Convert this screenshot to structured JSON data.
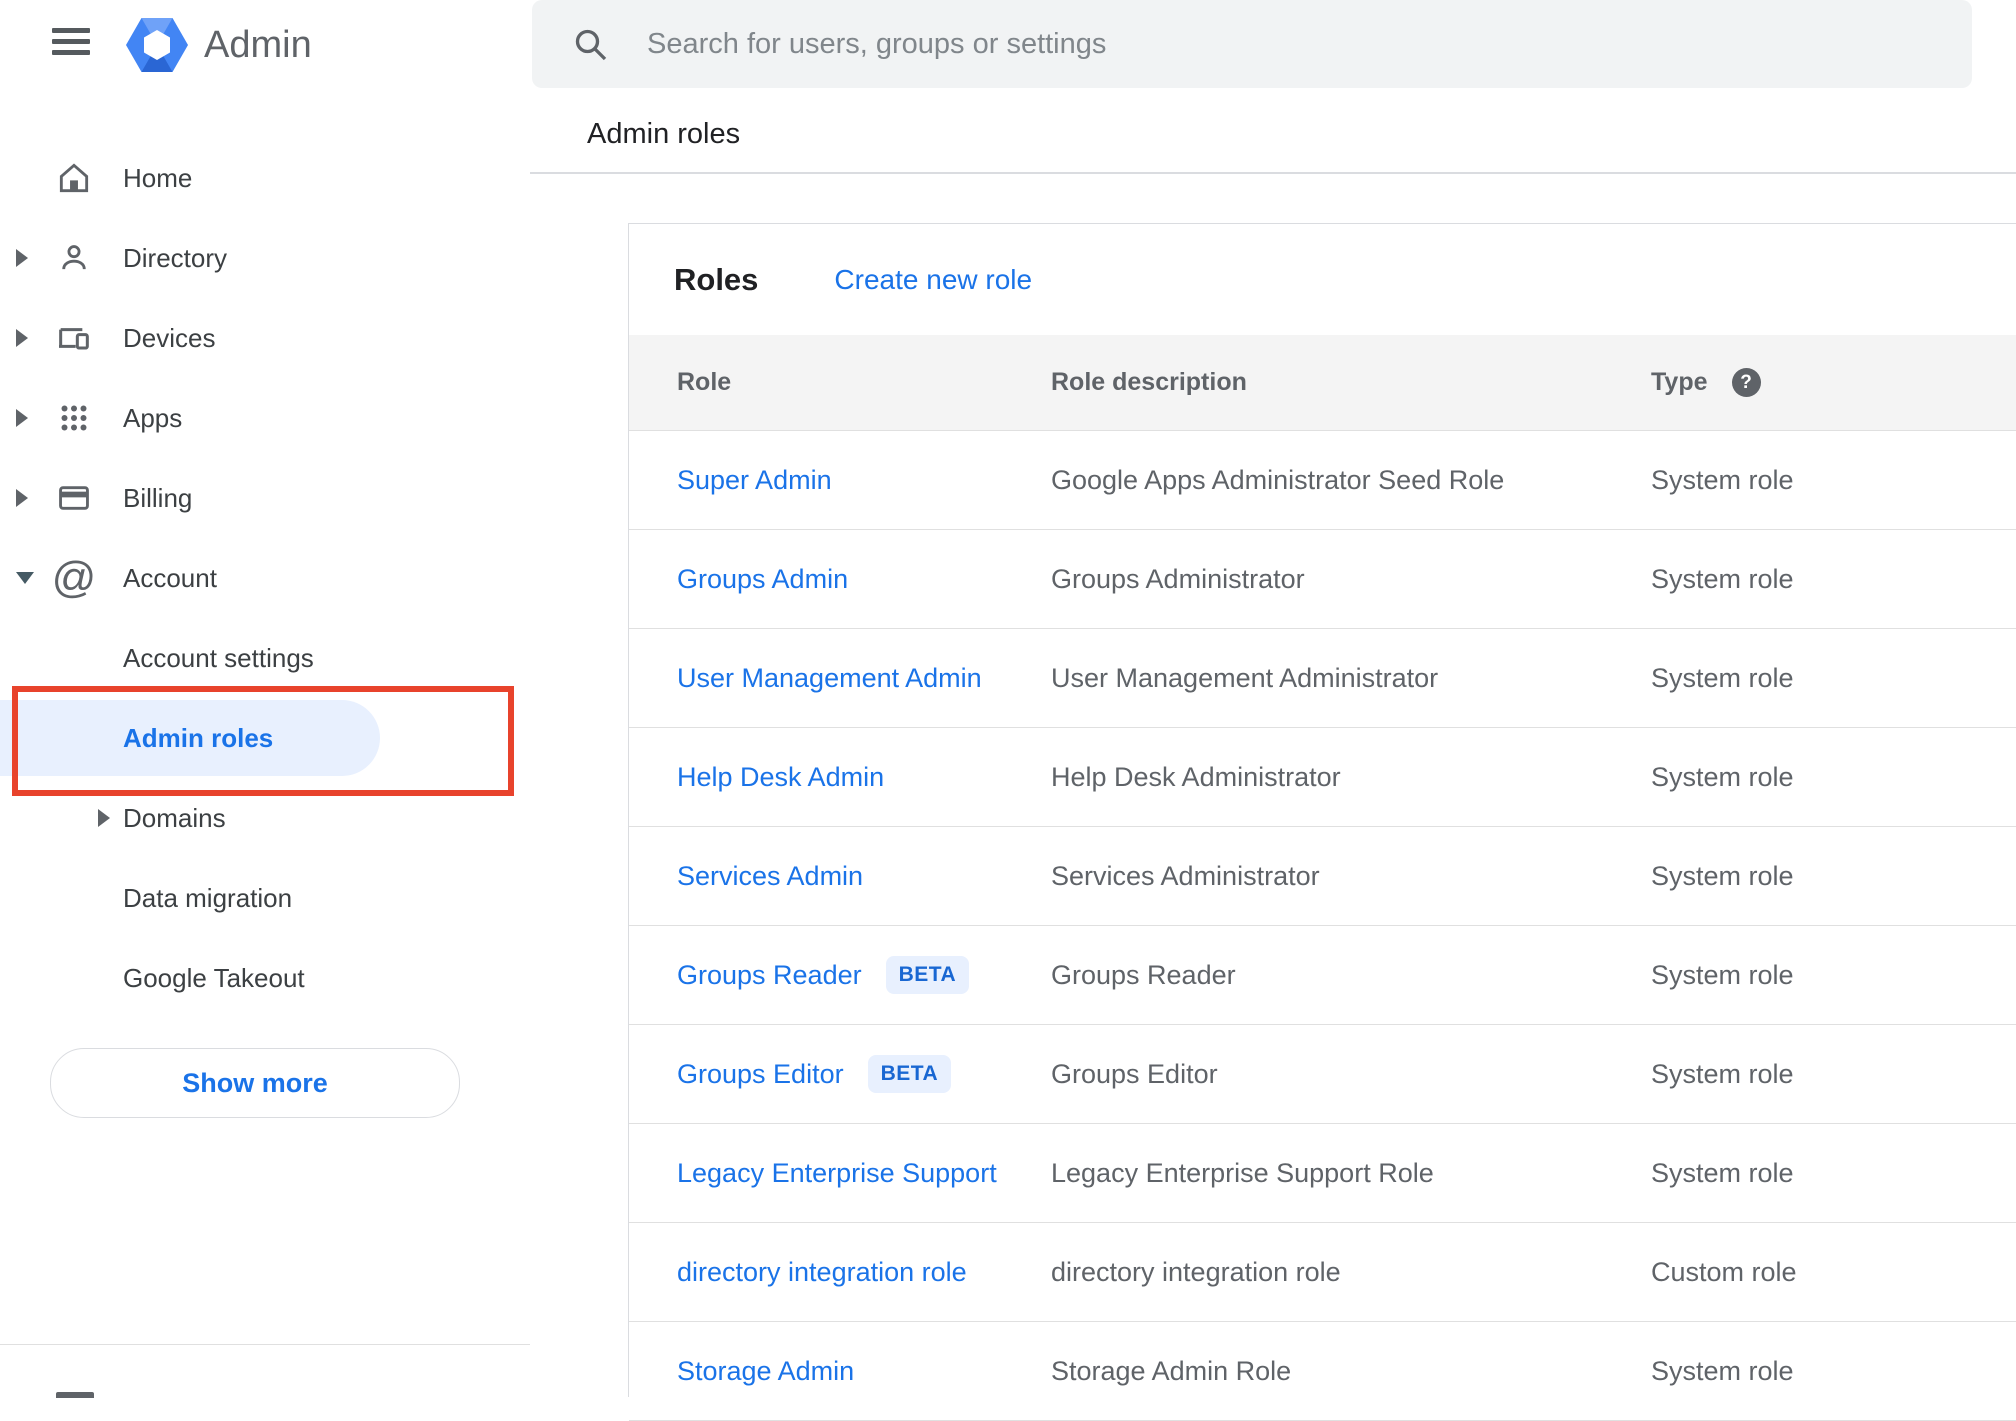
{
  "app": {
    "brand": "Admin"
  },
  "search": {
    "placeholder": "Search for users, groups or settings"
  },
  "page": {
    "title": "Admin roles"
  },
  "sidebar": {
    "items": [
      {
        "label": "Home"
      },
      {
        "label": "Directory"
      },
      {
        "label": "Devices"
      },
      {
        "label": "Apps"
      },
      {
        "label": "Billing"
      },
      {
        "label": "Account"
      }
    ],
    "account_subitems": [
      {
        "label": "Account settings"
      },
      {
        "label": "Admin roles",
        "selected": true
      },
      {
        "label": "Domains"
      },
      {
        "label": "Data migration"
      },
      {
        "label": "Google Takeout"
      }
    ],
    "show_more_label": "Show more"
  },
  "main": {
    "card_title": "Roles",
    "create_link": "Create new role",
    "table": {
      "columns": {
        "role": "Role",
        "description": "Role description",
        "type": "Type"
      },
      "help_icon": "?",
      "rows": [
        {
          "role": "Super Admin",
          "description": "Google Apps Administrator Seed Role",
          "type": "System role"
        },
        {
          "role": "Groups Admin",
          "description": "Groups Administrator",
          "type": "System role"
        },
        {
          "role": "User Management Admin",
          "description": "User Management Administrator",
          "type": "System role"
        },
        {
          "role": "Help Desk Admin",
          "description": "Help Desk Administrator",
          "type": "System role"
        },
        {
          "role": "Services Admin",
          "description": "Services Administrator",
          "type": "System role"
        },
        {
          "role": "Groups Reader",
          "badge": "BETA",
          "description": "Groups Reader",
          "type": "System role"
        },
        {
          "role": "Groups Editor",
          "badge": "BETA",
          "description": "Groups Editor",
          "type": "System role"
        },
        {
          "role": "Legacy Enterprise Support",
          "description": "Legacy Enterprise Support Role",
          "type": "System role"
        },
        {
          "role": "directory integration role",
          "description": "directory integration role",
          "type": "Custom role"
        },
        {
          "role": "Storage Admin",
          "description": "Storage Admin Role",
          "type": "System role"
        }
      ]
    }
  },
  "colors": {
    "accent_blue": "#1a73e8",
    "beta_blue": "#1967d2",
    "beta_bg": "#e8f0fe",
    "selected_bg": "#e8f0fe",
    "annotation_red": "#e8432c",
    "search_bg": "#f1f3f4",
    "table_header_bg": "#f4f4f4",
    "gray_text": "#5f6368"
  }
}
